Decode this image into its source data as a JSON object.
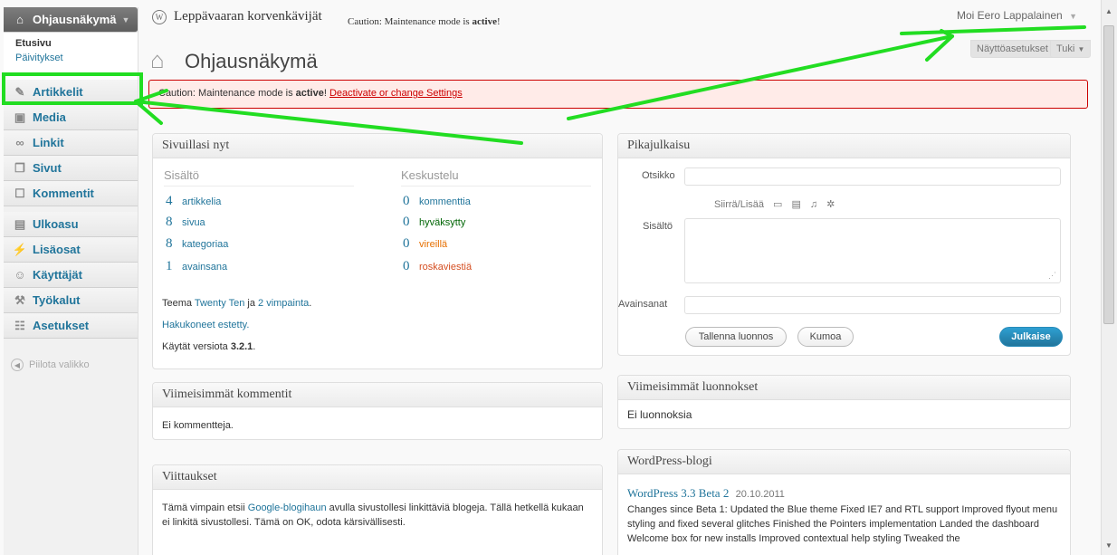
{
  "header": {
    "site_title": "Leppävaaran korvenkävijät",
    "maintenance_notice_pre": "Caution: Maintenance mode is ",
    "maintenance_notice_bold": "active",
    "maintenance_notice_post": "!",
    "howdy": "Moi Eero Lappalainen",
    "page_title": "Ohjausnäkymä",
    "screen_options": "Näyttöasetukset",
    "help": "Tuki"
  },
  "menu": {
    "dashboard": "Ohjausnäkymä",
    "sub_home": "Etusivu",
    "sub_updates": "Päivitykset",
    "posts": "Artikkelit",
    "media": "Media",
    "links": "Linkit",
    "pages": "Sivut",
    "comments": "Kommentit",
    "appearance": "Ulkoasu",
    "plugins": "Lisäosat",
    "users": "Käyttäjät",
    "tools": "Työkalut",
    "settings": "Asetukset",
    "collapse": "Piilota valikko"
  },
  "notice": {
    "pre": "Caution: Maintenance mode is ",
    "bold": "active",
    "post": "! ",
    "link": "Deactivate or change Settings"
  },
  "right_now": {
    "title": "Sivuillasi nyt",
    "content_head": "Sisältö",
    "discussion_head": "Keskustelu",
    "posts_num": "4",
    "posts_lbl": "artikkelia",
    "pages_num": "8",
    "pages_lbl": "sivua",
    "cats_num": "8",
    "cats_lbl": "kategoriaa",
    "tags_num": "1",
    "tags_lbl": "avainsana",
    "comments_num": "0",
    "comments_lbl": "kommenttia",
    "approved_num": "0",
    "approved_lbl": "hyväksytty",
    "pending_num": "0",
    "pending_lbl": "vireillä",
    "spam_num": "0",
    "spam_lbl": "roskaviestiä",
    "theme_pre": "Teema ",
    "theme_name": "Twenty Ten",
    "theme_mid": " ja ",
    "widgets": "2 vimpainta",
    "theme_post": ".",
    "search_blocked": "Hakukoneet estetty.",
    "version_pre": "Käytät versiota ",
    "version": "3.2.1",
    "version_post": "."
  },
  "recent_comments": {
    "title": "Viimeisimmät kommentit",
    "empty": "Ei kommentteja."
  },
  "incoming_links": {
    "title": "Viittaukset",
    "pre": "Tämä vimpain etsii ",
    "link": "Google-blogihaun",
    "post": " avulla sivustollesi linkittäviä blogeja. Tällä hetkellä kukaan ei linkitä sivustollesi. Tämä on OK, odota kärsivällisesti."
  },
  "quick_press": {
    "title": "Pikajulkaisu",
    "title_label": "Otsikko",
    "upload_label": "Siirrä/Lisää",
    "content_label": "Sisältö",
    "tags_label": "Avainsanat",
    "save_draft": "Tallenna luonnos",
    "reset": "Kumoa",
    "publish": "Julkaise"
  },
  "recent_drafts": {
    "title": "Viimeisimmät luonnokset",
    "empty": "Ei luonnoksia"
  },
  "wp_blog": {
    "title": "WordPress-blogi",
    "post_title": "WordPress 3.3 Beta 2",
    "post_date": "20.10.2011",
    "excerpt": "Changes since Beta 1: Updated the Blue theme Fixed IE7 and RTL support Improved flyout menu styling and fixed several glitches Finished the Pointers implementation Landed the dashboard Welcome box for new installs Improved contextual help styling Tweaked the"
  },
  "colors": {
    "link": "#21759b",
    "approved": "#006505",
    "pending": "#e66f00",
    "spam": "#d54e21",
    "notice_bg": "#ffebe8",
    "notice_border": "#cc0000",
    "annotation": "#22dd22"
  }
}
